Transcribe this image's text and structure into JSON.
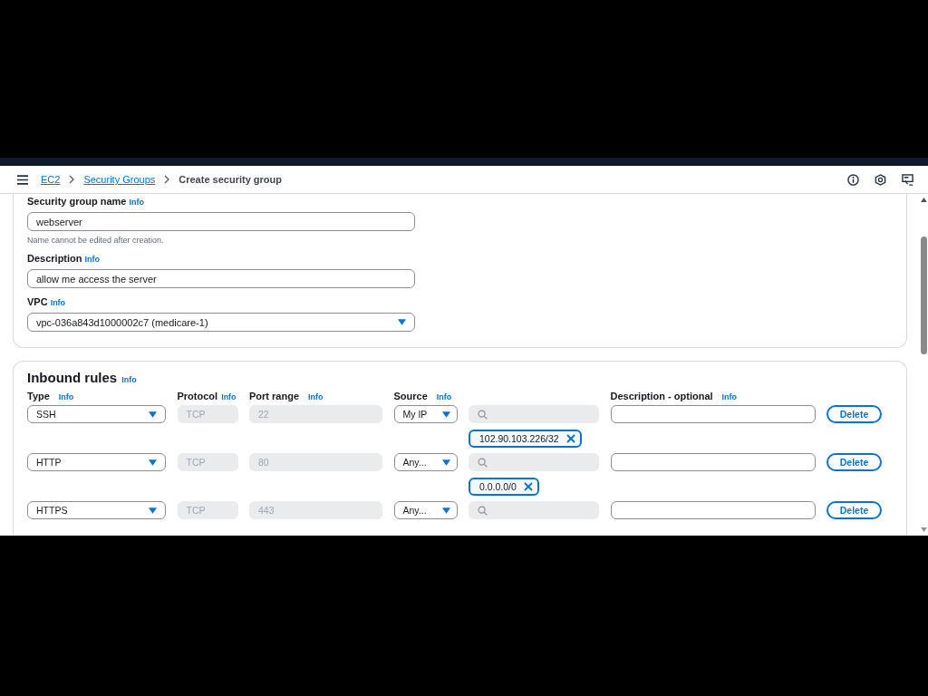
{
  "breadcrumbs": [
    {
      "label": "EC2",
      "kind": "link"
    },
    {
      "label": "Security Groups",
      "kind": "link"
    },
    {
      "label": "Create security group",
      "kind": "current"
    }
  ],
  "basic_details": {
    "fields": [
      {
        "label": "Security group name",
        "info": "Info",
        "kind": "text",
        "value": "webserver",
        "hint": "Name cannot be edited after creation."
      },
      {
        "label": "Description",
        "info": "Info",
        "kind": "text",
        "value": "allow me access the server"
      },
      {
        "label": "VPC",
        "info": "Info",
        "kind": "select",
        "value": "vpc-036a843d1000002c7 (medicare-1)"
      }
    ]
  },
  "inbound_rules": {
    "title": "Inbound rules",
    "info": "Info",
    "columns": [
      {
        "label": "Type",
        "info": "Info"
      },
      {
        "label": "Protocol",
        "info": "Info"
      },
      {
        "label": "Port range",
        "info": "Info"
      },
      {
        "label": "Source",
        "info": "Info"
      },
      {
        "label": "Description - optional",
        "info": "Info"
      }
    ],
    "rows": [
      {
        "type": "SSH",
        "protocol": "TCP",
        "port_range": "22",
        "source": "My IP",
        "source_chip": "102.90.103.226/32",
        "delete": "Delete"
      },
      {
        "type": "HTTP",
        "protocol": "TCP",
        "port_range": "80",
        "source": "Any...",
        "source_chip": "0.0.0.0/0",
        "delete": "Delete"
      },
      {
        "type": "HTTPS",
        "protocol": "TCP",
        "port_range": "443",
        "source": "Any...",
        "delete": "Delete"
      }
    ]
  }
}
